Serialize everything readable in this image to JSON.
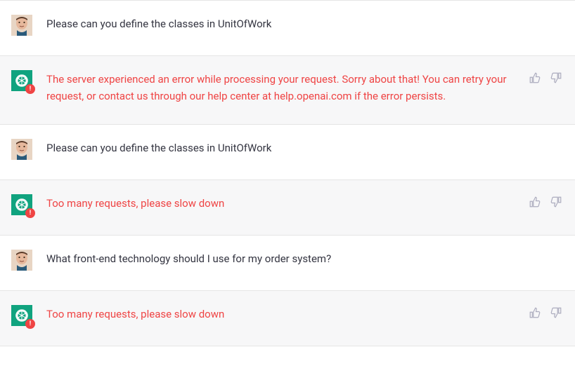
{
  "messages": [
    {
      "role": "user",
      "text": "Please can you define the classes in UnitOfWork",
      "error": false,
      "feedback": false
    },
    {
      "role": "assistant",
      "text": "The server experienced an error while processing your request. Sorry about that! You can retry your request, or contact us through our help center at help.openai.com if the error persists.",
      "error": true,
      "feedback": true
    },
    {
      "role": "user",
      "text": "Please can you define the classes in UnitOfWork",
      "error": false,
      "feedback": false
    },
    {
      "role": "assistant",
      "text": "Too many requests, please slow down",
      "error": true,
      "feedback": true
    },
    {
      "role": "user",
      "text": "What front-end technology should I use for my order system?",
      "error": false,
      "feedback": false
    },
    {
      "role": "assistant",
      "text": "Too many requests, please slow down",
      "error": true,
      "feedback": true
    }
  ],
  "icons": {
    "error_badge_glyph": "!"
  }
}
